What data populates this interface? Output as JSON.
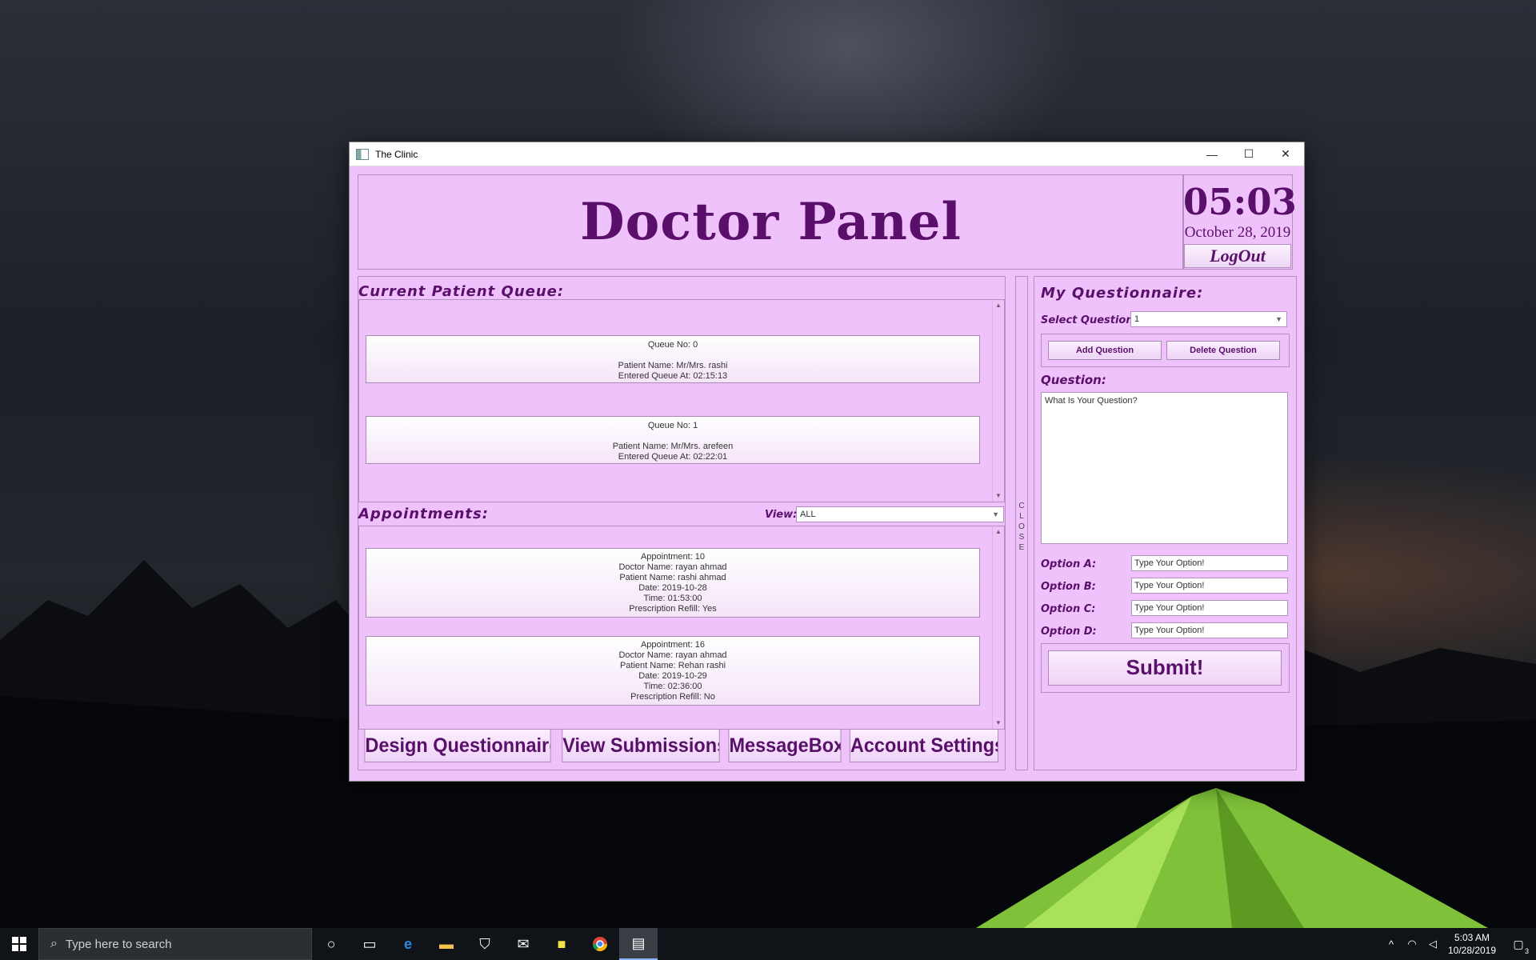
{
  "window": {
    "title": "The Clinic",
    "minimize": "—",
    "maximize": "☐",
    "close": "✕"
  },
  "header": {
    "title": "Doctor Panel",
    "time": "05:03",
    "date": "October 28, 2019",
    "logout": "LogOut"
  },
  "queue": {
    "label": "Current Patient Queue:",
    "items": [
      {
        "queue_no": "Queue No: 0",
        "patient": "Patient Name: Mr/Mrs. rashi",
        "entered": "Entered Queue At: 02:15:13"
      },
      {
        "queue_no": "Queue No: 1",
        "patient": "Patient Name: Mr/Mrs. arefeen",
        "entered": "Entered Queue At: 02:22:01"
      }
    ]
  },
  "appointments": {
    "label": "Appointments:",
    "view_label": "View:",
    "view_value": "ALL",
    "items": [
      {
        "id": "Appointment: 10",
        "doctor": "Doctor Name: rayan ahmad",
        "patient": "Patient Name: rashi ahmad",
        "date": "Date: 2019-10-28",
        "time": "Time: 01:53:00",
        "refill": "Prescription Refill: Yes"
      },
      {
        "id": "Appointment: 16",
        "doctor": "Doctor Name: rayan ahmad",
        "patient": "Patient Name: Rehan rashi",
        "date": "Date: 2019-10-29",
        "time": "Time: 02:36:00",
        "refill": "Prescription Refill: No"
      }
    ]
  },
  "nav": {
    "design": "Design Questionnaire",
    "submissions": "View Submissions",
    "messagebox": "MessageBox",
    "settings": "Account Settings"
  },
  "close_strip": [
    "C",
    "L",
    "O",
    "S",
    "E"
  ],
  "questionnaire": {
    "title": "My Questionnaire:",
    "select_label": "Select Question:",
    "select_value": "1",
    "add_button": "Add Question",
    "delete_button": "Delete Question",
    "question_label": "Question:",
    "question_text": "What Is Your Question?",
    "option_a_label": "Option A:",
    "option_b_label": "Option B:",
    "option_c_label": "Option C:",
    "option_d_label": "Option D:",
    "option_a": "Type Your Option!",
    "option_b": "Type Your Option!",
    "option_c": "Type Your Option!",
    "option_d": "Type Your Option!",
    "submit": "Submit!"
  },
  "taskbar": {
    "search_placeholder": "Type here to search",
    "time": "5:03 AM",
    "date": "10/28/2019",
    "notifications": "3"
  }
}
